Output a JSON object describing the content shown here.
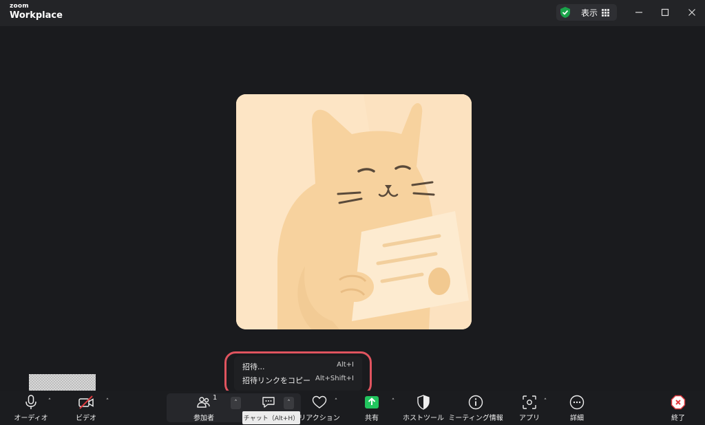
{
  "app": {
    "brand_small": "zoom",
    "brand_big": "Workplace"
  },
  "titlebar": {
    "view_label": "表示"
  },
  "popup": {
    "items": [
      {
        "label": "招待...",
        "shortcut": "Alt+I"
      },
      {
        "label": "招待リンクをコピー",
        "shortcut": "Alt+Shift+I"
      }
    ]
  },
  "toolbar": {
    "audio": "オーディオ",
    "video": "ビデオ",
    "participants": "参加者",
    "participants_count": "1",
    "chat": "",
    "reactions": "リアクション",
    "share": "共有",
    "host_tools": "ホストツール",
    "meeting_info": "ミーティング情報",
    "apps": "アプリ",
    "more": "詳細",
    "end": "終了"
  },
  "tooltip": {
    "chat": "チャット（Alt+H）"
  },
  "colors": {
    "highlight": "#e0545f",
    "share_green": "#22c55e",
    "end_red": "#e0393e",
    "shield_green": "#1aa34a"
  }
}
